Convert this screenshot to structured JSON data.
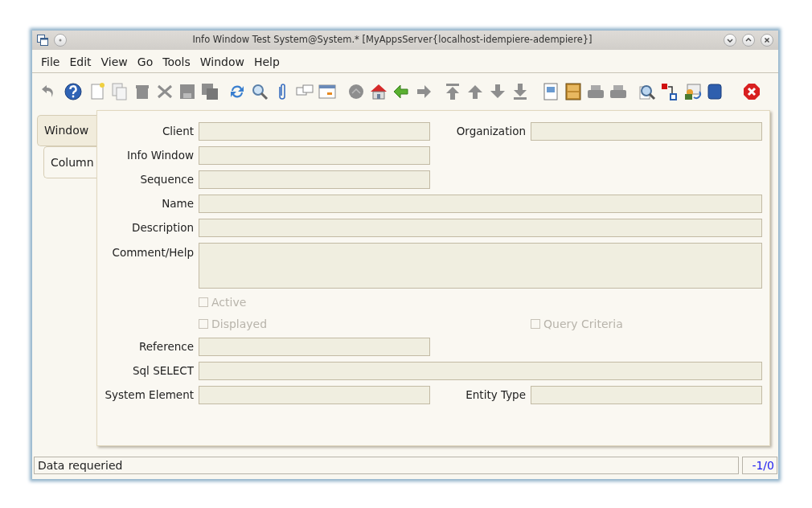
{
  "window": {
    "title": "Info Window  Test  System@System.* [MyAppsServer{localhost-idempiere-adempiere}]"
  },
  "menu": [
    {
      "label": "File"
    },
    {
      "label": "Edit"
    },
    {
      "label": "View"
    },
    {
      "label": "Go"
    },
    {
      "label": "Tools"
    },
    {
      "label": "Window"
    },
    {
      "label": "Help"
    }
  ],
  "tabs": [
    {
      "label": "Window",
      "selected": true
    },
    {
      "label": "Column",
      "selected": false
    }
  ],
  "form": {
    "rows": [
      {
        "items": [
          {
            "kind": "field",
            "label": "Client"
          },
          {
            "kind": "field",
            "label": "Organization"
          }
        ]
      },
      {
        "items": [
          {
            "kind": "field",
            "label": "Info Window"
          }
        ]
      },
      {
        "items": [
          {
            "kind": "field",
            "label": "Sequence"
          }
        ]
      },
      {
        "items": [
          {
            "kind": "wide_field",
            "label": "Name"
          }
        ]
      },
      {
        "items": [
          {
            "kind": "wide_field",
            "label": "Description"
          }
        ]
      },
      {
        "items": [
          {
            "kind": "textarea",
            "label": "Comment/Help"
          }
        ]
      },
      {
        "items": [
          {
            "kind": "checkbox",
            "label": "Active",
            "checked": false,
            "disabled": true
          }
        ]
      },
      {
        "items": [
          {
            "kind": "checkbox",
            "label": "Displayed",
            "checked": false,
            "disabled": true
          },
          {
            "kind": "checkbox",
            "label": "Query Criteria",
            "checked": false,
            "disabled": true
          }
        ]
      },
      {
        "items": [
          {
            "kind": "field",
            "label": "Reference"
          }
        ]
      },
      {
        "items": [
          {
            "kind": "wide_field",
            "label": "Sql SELECT"
          }
        ]
      },
      {
        "items": [
          {
            "kind": "field",
            "label": "System Element"
          },
          {
            "kind": "field",
            "label": "Entity Type"
          }
        ]
      }
    ]
  },
  "status_bar": {
    "message": "Data requeried",
    "record": "-1/0"
  }
}
